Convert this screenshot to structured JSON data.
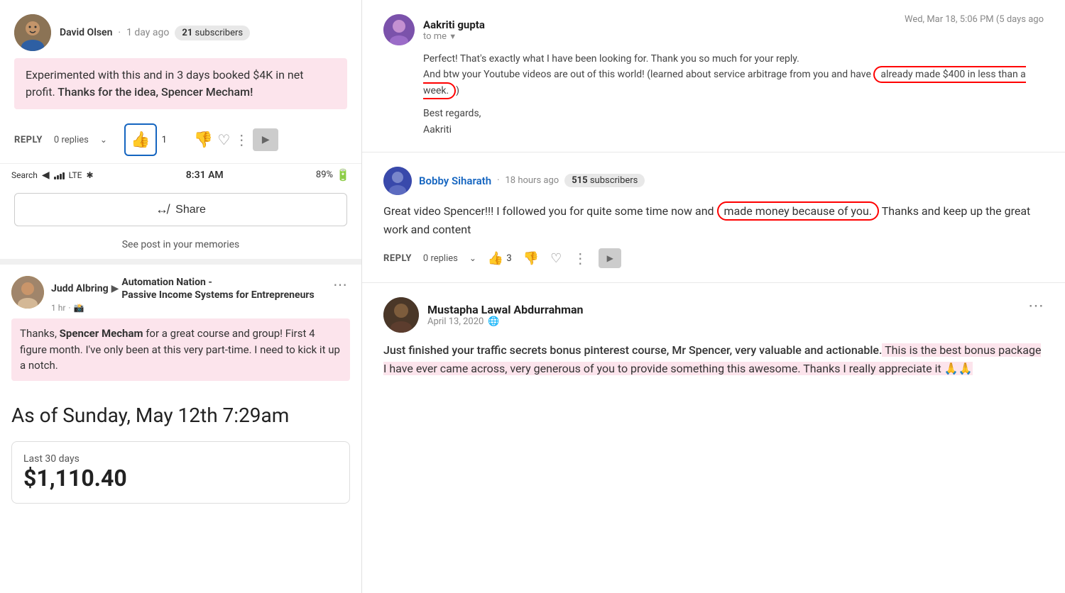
{
  "left": {
    "david": {
      "name": "David Olsen",
      "dot": "·",
      "time": "1 day ago",
      "subscribers_num": "21",
      "subscribers_label": "subscribers",
      "comment_part1": "Experimented with this and in 3 days booked $4K in net profit.",
      "comment_part2": " Thanks for the idea, Spencer Mecham!",
      "reply_label": "REPLY",
      "replies_label": "0 replies",
      "like_count": "1"
    },
    "status_bar": {
      "search": "Search",
      "signal": "LTE",
      "time": "8:31 AM",
      "battery_pct": "89%"
    },
    "share_btn": "Share",
    "memories_link": "See post in your memories",
    "judd": {
      "name": "Judd Albring",
      "arrow": "▶",
      "group_part1": "Automation Nation -",
      "group_part2": "Passive Income Systems for Entrepreneurs",
      "time": "1 hr",
      "post_text_part1": "Thanks, ",
      "post_name": "Spencer Mecham",
      "post_text_part2": " for a great course and group! First 4 figure month. I've only been at this very part-time. I need to kick it up a notch."
    },
    "as_of": {
      "title": "As of Sunday, May 12th 7:29am"
    },
    "stats": {
      "label": "Last 30 days",
      "value": "$1,110.40"
    }
  },
  "right": {
    "email": {
      "sender": "Aakriti gupta",
      "to_label": "to me",
      "date": "Wed, Mar 18, 5:06 PM (5 days ago",
      "body_part1": "Perfect! That's exactly what I have been looking for. Thank you so much for your reply.",
      "body_part2": "And btw your Youtube videos are out of this world! (learned about service arbitrage from you and have ",
      "body_highlight": "already made $400 in less than a week.",
      "body_part3": ")",
      "regards": "Best regards,",
      "name_sign": "Aakriti"
    },
    "bobby": {
      "name": "Bobby Siharath",
      "dot": "·",
      "time": "18 hours ago",
      "subscribers_num": "515",
      "subscribers_label": "subscribers",
      "comment_part1": "Great video Spencer!!! I followed you for quite some time now and ",
      "comment_highlight": "made money because of you.",
      "comment_part2": " Thanks and keep up the great work and content",
      "reply_label": "REPLY",
      "replies_label": "0 replies",
      "like_count": "3"
    },
    "mustapha": {
      "name": "Mustapha Lawal Abdurrahman",
      "date": "April 13, 2020",
      "text_part1": "Just finished your traffic secrets bonus pinterest course, Mr Spencer, very valuable and actionable.",
      "text_part2": " This is the best bonus package I have ever came across, very generous of you to provide something this awesome. Thanks I really appreciate it 🙏🙏"
    }
  }
}
